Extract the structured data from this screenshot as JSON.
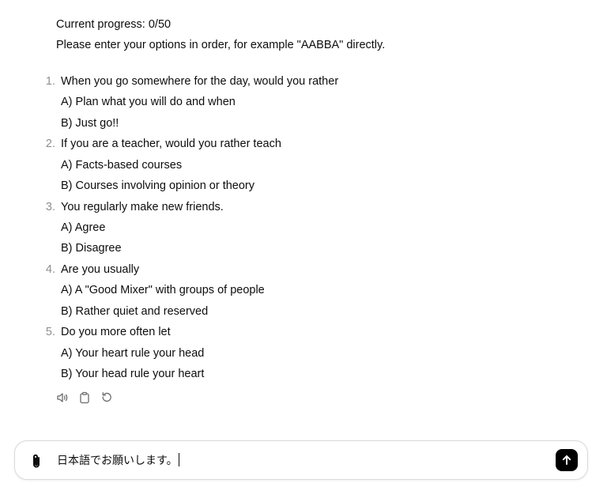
{
  "status": {
    "progress": "Current progress: 0/50",
    "instructions": "Please enter your options in order, for example \"AABBA\" directly."
  },
  "questions": [
    {
      "number": "1.",
      "text": "When you go somewhere for the day, would you rather",
      "option_a": "A) Plan what you will do and when",
      "option_b": "B) Just go!!"
    },
    {
      "number": "2.",
      "text": "If you are a teacher, would you rather teach",
      "option_a": "A) Facts-based courses",
      "option_b": "B) Courses involving opinion or theory"
    },
    {
      "number": "3.",
      "text": "You regularly make new friends.",
      "option_a": "A) Agree",
      "option_b": "B) Disagree"
    },
    {
      "number": "4.",
      "text": "Are you usually",
      "option_a": "A) A \"Good Mixer\" with groups of people",
      "option_b": "B) Rather quiet and reserved"
    },
    {
      "number": "5.",
      "text": "Do you more often let",
      "option_a": "A) Your heart rule your head",
      "option_b": "B) Your head rule your heart"
    }
  ],
  "message_actions": {
    "icons": [
      "speaker-icon",
      "copy-icon",
      "regenerate-icon"
    ]
  },
  "composer": {
    "value": "日本語でお願いします。",
    "icons": [
      "paperclip-icon",
      "send-arrow-icon"
    ]
  },
  "colors": {
    "text": "#0d0d0d",
    "muted": "#8e8e8e",
    "send_button": "#000000",
    "composer_border": "#d9d9d9"
  }
}
